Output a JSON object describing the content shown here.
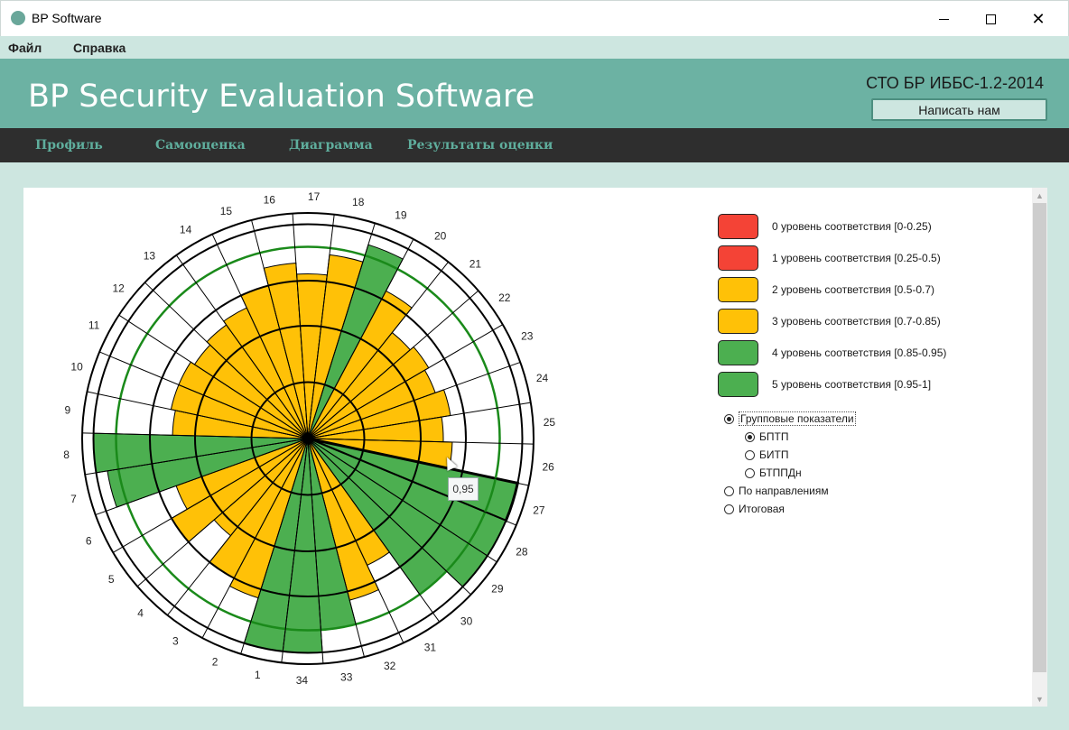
{
  "window": {
    "title": "BP Software"
  },
  "menu": {
    "file": "Файл",
    "help": "Справка"
  },
  "header": {
    "title": "BP Security Evaluation Software",
    "standard": "СТО БР ИББС-1.2-2014",
    "contact_button": "Написать нам"
  },
  "nav": {
    "profile": "Профиль",
    "self_assessment": "Самооценка",
    "diagram": "Диаграмма",
    "results": "Результаты оценки"
  },
  "legend": [
    {
      "label": "0 уровень соответствия [0-0.25)",
      "color": "#f44336"
    },
    {
      "label": "1 уровень соответствия [0.25-0.5)",
      "color": "#f44336"
    },
    {
      "label": "2 уровень соответствия [0.5-0.7)",
      "color": "#ffc107"
    },
    {
      "label": "3 уровень соответствия [0.7-0.85)",
      "color": "#ffc107"
    },
    {
      "label": "4 уровень соответствия [0.85-0.95)",
      "color": "#4caf50"
    },
    {
      "label": "5 уровень соответствия [0.95-1]",
      "color": "#4caf50"
    }
  ],
  "view_options": {
    "group": {
      "label": "Групповые показатели",
      "selected": true
    },
    "group_items": [
      {
        "label": "БПТП",
        "selected": true
      },
      {
        "label": "БИТП",
        "selected": false
      },
      {
        "label": "БТППДн",
        "selected": false
      }
    ],
    "by_direction": {
      "label": "По направлениям",
      "selected": false
    },
    "total": {
      "label": "Итоговая",
      "selected": false
    }
  },
  "tooltip": {
    "value": "0,95"
  },
  "chart_data": {
    "type": "polar-bar",
    "categories": [
      "1",
      "2",
      "3",
      "4",
      "5",
      "6",
      "7",
      "8",
      "9",
      "10",
      "11",
      "12",
      "13",
      "14",
      "15",
      "16",
      "17",
      "18",
      "19",
      "20",
      "21",
      "22",
      "23",
      "24",
      "25",
      "26",
      "27",
      "28",
      "29",
      "30",
      "31",
      "32",
      "33",
      "34"
    ],
    "values": [
      0.95,
      0.74,
      0.7,
      0.55,
      0.7,
      0.62,
      0.9,
      0.95,
      0.6,
      0.62,
      0.62,
      0.6,
      0.62,
      0.64,
      0.7,
      0.78,
      0.73,
      0.82,
      0.9,
      0.74,
      0.6,
      0.62,
      0.6,
      0.64,
      0.6,
      0.64,
      0.95,
      0.95,
      0.95,
      0.85,
      0.62,
      0.74,
      0.85,
      0.95
    ],
    "highlighted_category": "27",
    "grid_levels": [
      0.25,
      0.5,
      0.7,
      0.85,
      0.95,
      1.0
    ],
    "reference_level": 0.85,
    "level_colors": {
      "low": "#f44336",
      "mid": "#ffc107",
      "high": "#4caf50"
    }
  }
}
